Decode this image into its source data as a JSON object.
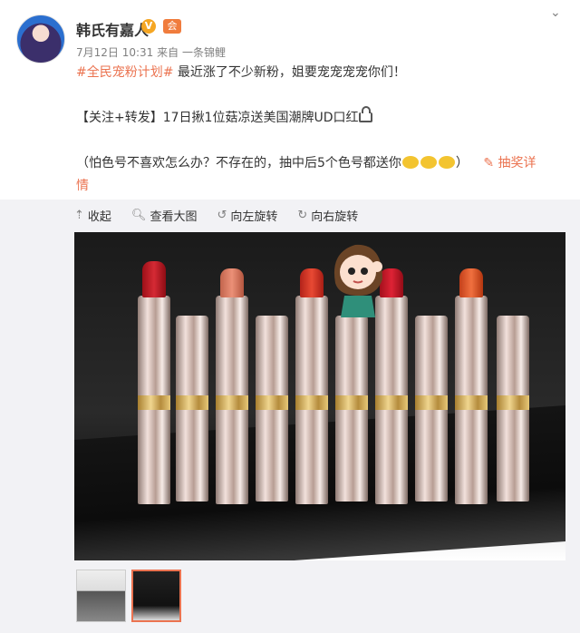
{
  "post": {
    "username": "韩氏有嘉人",
    "verified_badge": "V",
    "vip_badge": "会",
    "meta_time": "7月12日 10:31",
    "meta_from": "来自 一条锦鲤",
    "tag": "#全民宠粉计划#",
    "line1_rest": " 最近涨了不少新粉，姐要宠宠宠宠你们！",
    "line2": "【关注+转发】17日揪1位菇凉送美国潮牌UD口红",
    "line3_a": "（怕色号不喜欢怎么办？不存在的，抽中后5个色号都送你",
    "line3_b": "）",
    "lottery_link": "抽奖详",
    "lottery_link_2": "情"
  },
  "toolbar": {
    "collapse": "收起",
    "view_large": "查看大图",
    "rotate_left": "向左旋转",
    "rotate_right": "向右旋转"
  },
  "icons": [
    "collapse-arrow-icon",
    "zoom-icon",
    "rotate-left-icon",
    "rotate-right-icon",
    "link-icon",
    "chevron-down-icon"
  ],
  "colors": {
    "accent": "#eb7350",
    "text": "#333333",
    "muted": "#808080",
    "panel": "#f2f2f5"
  }
}
